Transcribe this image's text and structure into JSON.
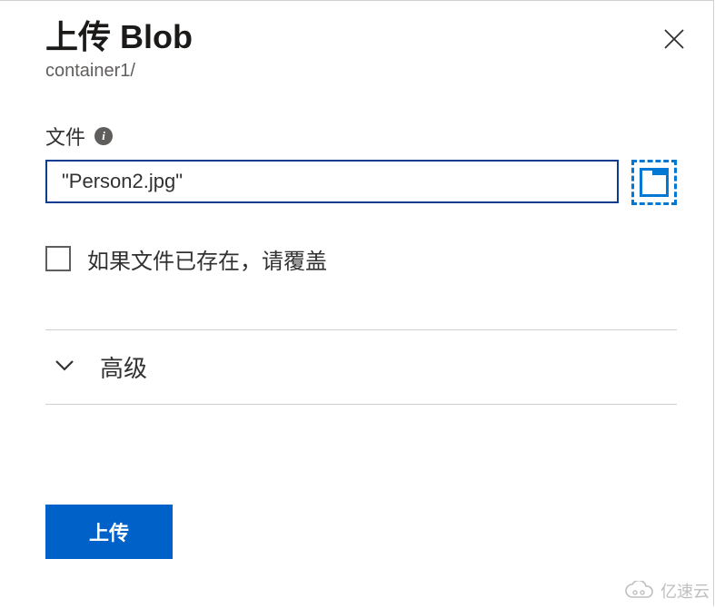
{
  "header": {
    "title": "上传 Blob",
    "subtitle": "container1/"
  },
  "file_field": {
    "label": "文件",
    "value": "\"Person2.jpg\""
  },
  "overwrite": {
    "label": "如果文件已存在，请覆盖",
    "checked": false
  },
  "advanced": {
    "label": "高级"
  },
  "actions": {
    "upload_label": "上传"
  },
  "watermark": {
    "text": "亿速云"
  },
  "colors": {
    "primary": "#0062c9",
    "accent": "#0078d4",
    "input_border": "#0a3d8f"
  }
}
